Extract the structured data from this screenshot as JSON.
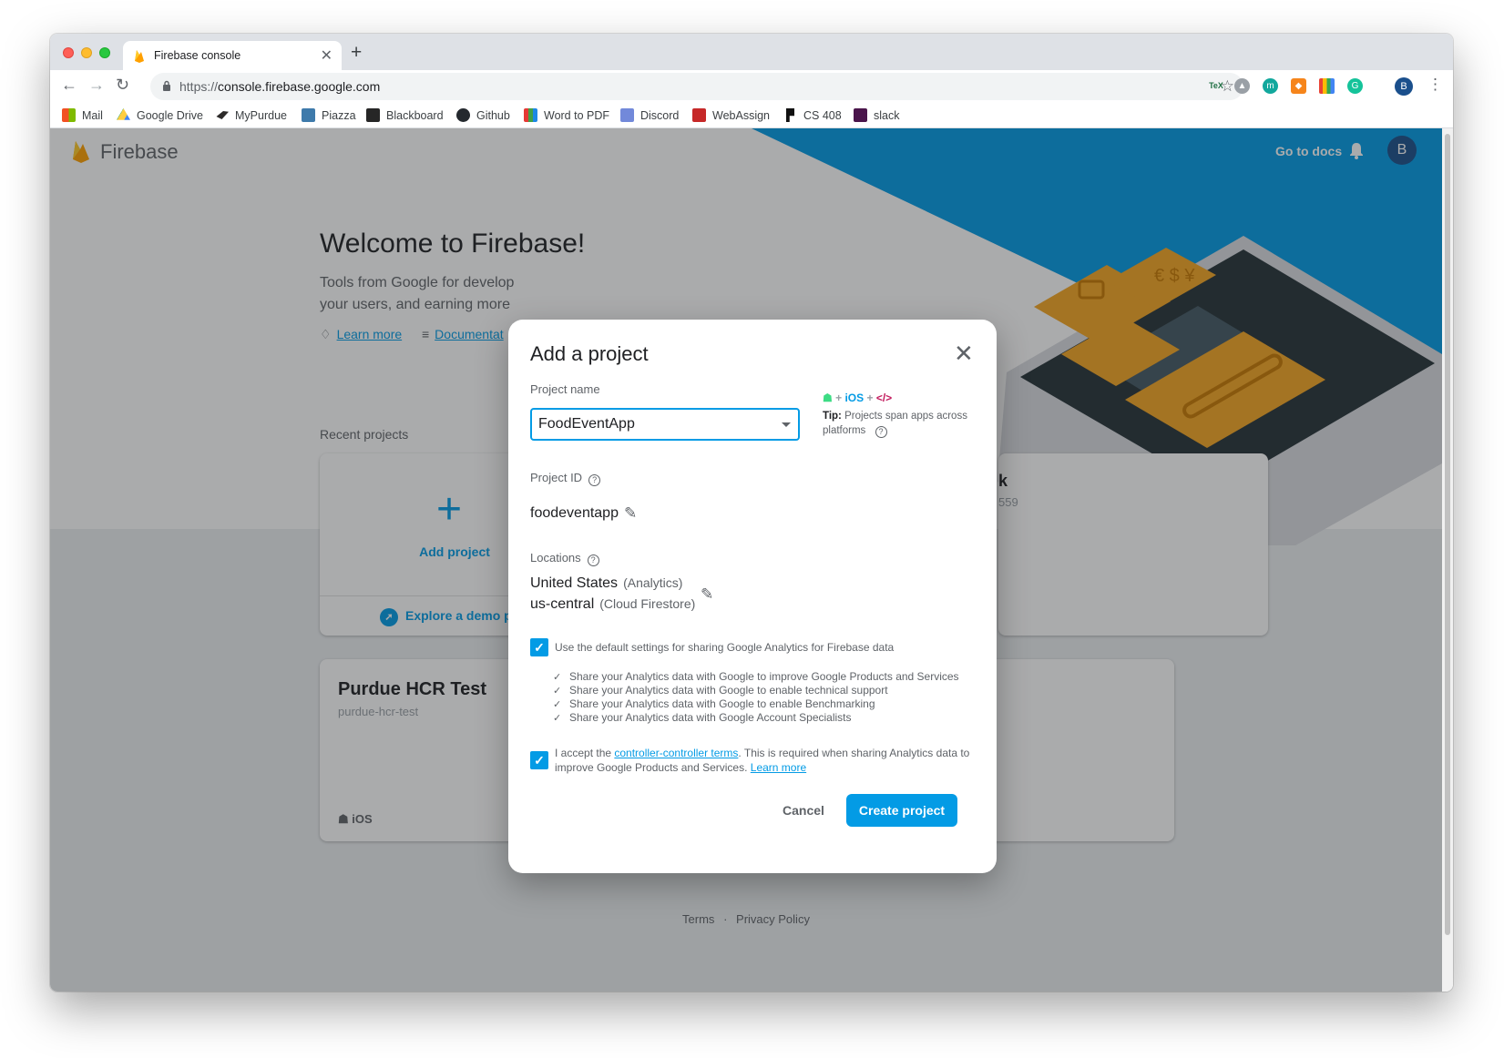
{
  "browser": {
    "tab_title": "Firebase console",
    "url_scheme": "https://",
    "url_host": "console.firebase.google.com",
    "profile_initial": "B",
    "bookmarks": [
      "Mail",
      "Google Drive",
      "MyPurdue",
      "Piazza",
      "Blackboard",
      "Github",
      "Word to PDF",
      "Discord",
      "WebAssign",
      "CS 408",
      "slack"
    ],
    "extension_label": "TeX"
  },
  "header": {
    "brand": "Firebase",
    "go_to_docs": "Go to docs",
    "avatar_initial": "B"
  },
  "welcome": {
    "title": "Welcome to Firebase!",
    "subtitle_line1": "Tools from Google for develop",
    "subtitle_line2": "your users, and earning more",
    "learn_more": "Learn more",
    "documentation": "Documentat"
  },
  "projects": {
    "section_label": "Recent projects",
    "add_project": "Add project",
    "explore_demo": "Explore a demo pr",
    "card2_title": "k",
    "card2_subtitle": "559",
    "hcr_title": "Purdue HCR Test",
    "hcr_id": "purdue-hcr-test",
    "hcr_platform": "iOS"
  },
  "footer": {
    "terms": "Terms",
    "separator": "·",
    "privacy": "Privacy Policy"
  },
  "modal": {
    "title": "Add a project",
    "project_name_label": "Project name",
    "project_name_value": "FoodEventApp",
    "tip_ios": "iOS",
    "tip_bold": "Tip:",
    "tip_text": "Projects span apps across platforms",
    "project_id_label": "Project ID",
    "project_id_value": "foodeventapp",
    "locations_label": "Locations",
    "location1": "United States",
    "location1_note": "(Analytics)",
    "location2": "us-central",
    "location2_note": "(Cloud Firestore)",
    "default_settings": "Use the default settings for sharing Google Analytics for Firebase data",
    "shares": [
      "Share your Analytics data with Google to improve Google Products and Services",
      "Share your Analytics data with Google to enable technical support",
      "Share your Analytics data with Google to enable Benchmarking",
      "Share your Analytics data with Google Account Specialists"
    ],
    "accept_prefix": "I accept the ",
    "accept_link": "controller-controller terms",
    "accept_suffix": ". This is required when sharing Analytics data to improve Google Products and Services. ",
    "accept_learn_more": "Learn more",
    "cancel": "Cancel",
    "create": "Create project"
  },
  "colors": {
    "accent": "#039be5",
    "firebase_orange": "#ffa000",
    "illustration_orange": "#f5a623"
  }
}
